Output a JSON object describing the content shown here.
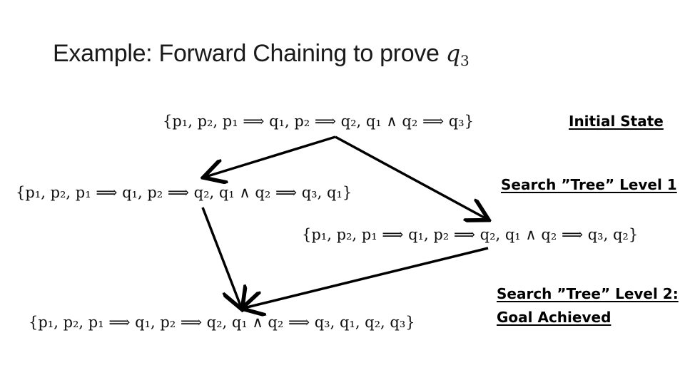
{
  "slide": {
    "title_text": "Example: Forward Chaining to prove ",
    "title_var": "q",
    "title_sub": "3"
  },
  "states": {
    "initial": "{p₁, p₂, p₁ ⟹ q₁, p₂ ⟹ q₂, q₁ ∧ q₂ ⟹ q₃}",
    "level1_left": "{p₁, p₂, p₁ ⟹ q₁, p₂ ⟹ q₂, q₁ ∧ q₂ ⟹ q₃, q₁}",
    "level1_right": "{p₁, p₂, p₁ ⟹ q₁, p₂ ⟹ q₂, q₁ ∧ q₂ ⟹ q₃, q₂}",
    "level2": "{p₁, p₂, p₁ ⟹ q₁, p₂ ⟹ q₂, q₁ ∧ q₂ ⟹ q₃, q₁, q₂, q₃}"
  },
  "labels": {
    "initial": "Initial State",
    "level1": "Search ”Tree” Level 1",
    "level2_line1": "Search ”Tree” Level 2:",
    "level2_line2": "Goal Achieved"
  },
  "edges": [
    {
      "from": "initial",
      "to": "level1_left"
    },
    {
      "from": "initial",
      "to": "level1_right"
    },
    {
      "from": "level1_left",
      "to": "level2"
    },
    {
      "from": "level1_right",
      "to": "level2"
    }
  ],
  "colors": {
    "arrow": "#000000",
    "text": "#111111"
  }
}
